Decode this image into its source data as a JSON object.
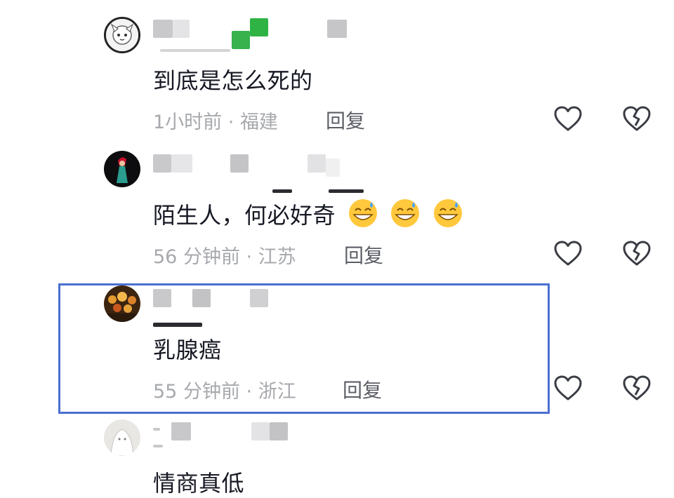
{
  "comments": [
    {
      "text": "到底是怎么死的",
      "time": "1小时前",
      "location": "福建",
      "meta_sep": " · ",
      "reply_label": "回复"
    },
    {
      "text": "陌生人，何必好奇",
      "emoji_count": 3,
      "time": "56 分钟前",
      "location": "江苏",
      "meta_sep": " · ",
      "reply_label": "回复"
    },
    {
      "text": "乳腺癌",
      "time": "55 分钟前",
      "location": "浙江",
      "meta_sep": " · ",
      "reply_label": "回复"
    },
    {
      "text": "情商真低"
    }
  ],
  "icons": {
    "like": "heart-outline-icon",
    "dislike": "broken-heart-icon",
    "emoji": "grinning-sweat-emoji"
  },
  "colors": {
    "highlight_border": "#4a6fd0",
    "meta_text": "#a7a9ad",
    "reply_text": "#5b5e66"
  }
}
